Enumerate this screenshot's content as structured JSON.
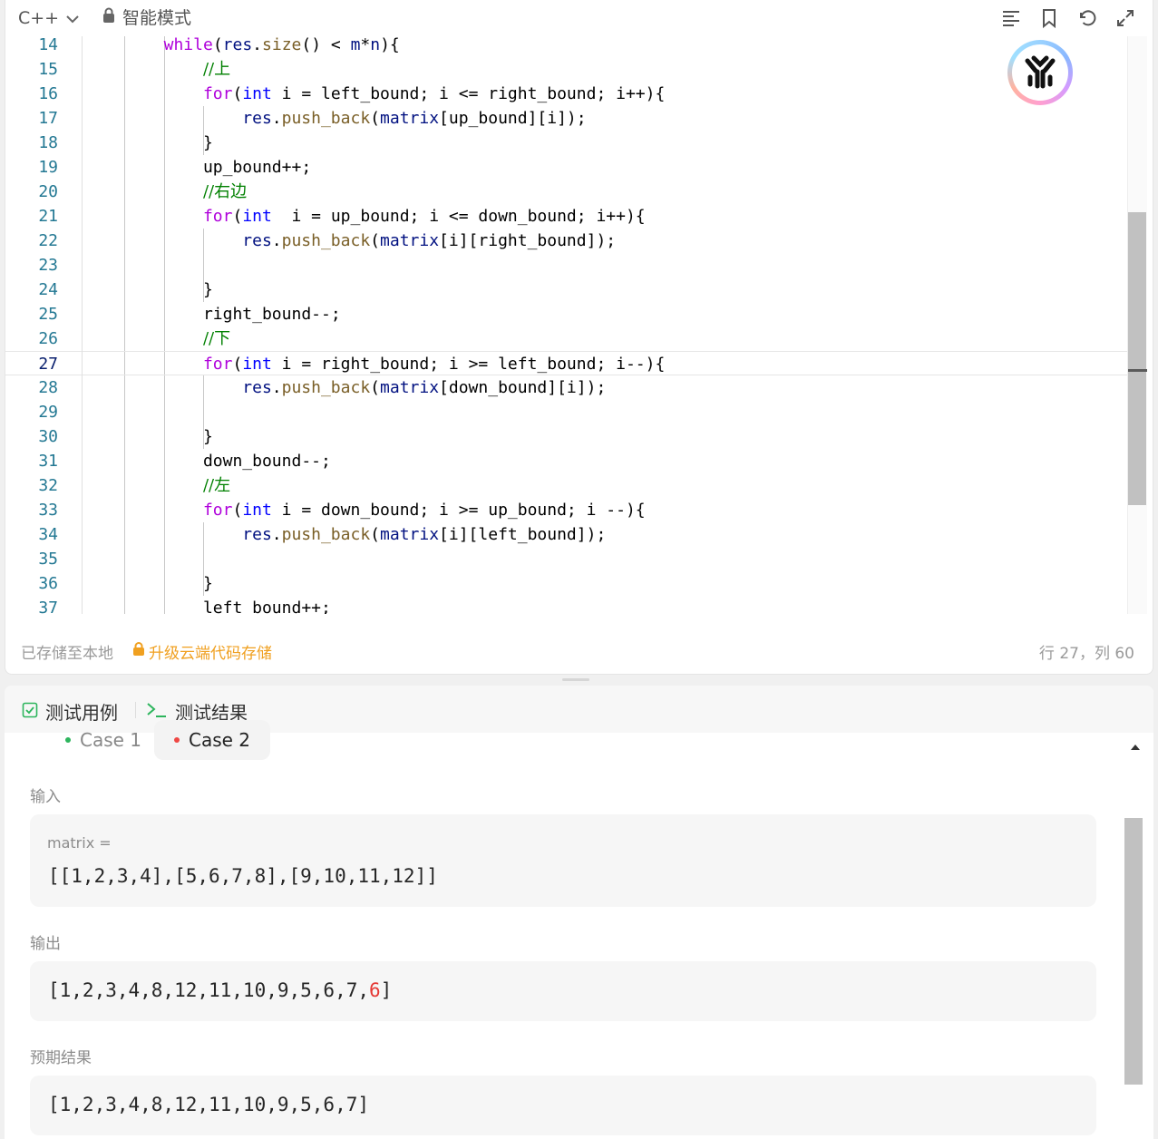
{
  "toolbar": {
    "language": "C++",
    "mode": "智能模式"
  },
  "code": {
    "lines": [
      {
        "n": "14",
        "html": "<span class=\"kw2\">while</span>(<span class=\"var\">res</span>.<span class=\"fn\">size</span>() &lt; <span class=\"var\">m</span>*<span class=\"var\">n</span>){"
      },
      {
        "n": "15",
        "html": "<span class=\"cm\">//上</span>"
      },
      {
        "n": "16",
        "html": "<span class=\"kw2\">for</span>(<span class=\"kw\">int</span> i = left_bound; i &lt;= right_bound; i++){"
      },
      {
        "n": "17",
        "html": "<span class=\"var\">res</span>.<span class=\"fn\">push_back</span>(<span class=\"var\">matrix</span>[up_bound][i]);"
      },
      {
        "n": "18",
        "html": "}"
      },
      {
        "n": "19",
        "html": "up_bound++;"
      },
      {
        "n": "20",
        "html": "<span class=\"cm\">//右边</span>"
      },
      {
        "n": "21",
        "html": "<span class=\"kw2\">for</span>(<span class=\"kw\">int</span>  i = up_bound; i &lt;= down_bound; i++){"
      },
      {
        "n": "22",
        "html": "<span class=\"var\">res</span>.<span class=\"fn\">push_back</span>(<span class=\"var\">matrix</span>[i][right_bound]);"
      },
      {
        "n": "23",
        "html": ""
      },
      {
        "n": "24",
        "html": "}"
      },
      {
        "n": "25",
        "html": "right_bound--;"
      },
      {
        "n": "26",
        "html": "<span class=\"cm\">//下</span>"
      },
      {
        "n": "27",
        "html": "<span class=\"kw2\">for</span>(<span class=\"kw\">int</span> i = right_bound; i &gt;= left_bound; i--){"
      },
      {
        "n": "28",
        "html": "<span class=\"var\">res</span>.<span class=\"fn\">push_back</span>(<span class=\"var\">matrix</span>[down_bound][i]);"
      },
      {
        "n": "29",
        "html": ""
      },
      {
        "n": "30",
        "html": "}"
      },
      {
        "n": "31",
        "html": "down_bound--;"
      },
      {
        "n": "32",
        "html": "<span class=\"cm\">//左</span>"
      },
      {
        "n": "33",
        "html": "<span class=\"kw2\">for</span>(<span class=\"kw\">int</span> i = down_bound; i &gt;= up_bound; i --){"
      },
      {
        "n": "34",
        "html": "<span class=\"var\">res</span>.<span class=\"fn\">push_back</span>(<span class=\"var\">matrix</span>[i][left_bound]);"
      },
      {
        "n": "35",
        "html": ""
      },
      {
        "n": "36",
        "html": "}"
      },
      {
        "n": "37",
        "html": "left_bound++;"
      }
    ],
    "active_line": "27"
  },
  "status": {
    "saved": "已存储至本地",
    "upgrade": "升级云端代码存储",
    "cursor": "行 27，列 60"
  },
  "result": {
    "tab_testcase": "测试用例",
    "tab_result": "测试结果",
    "case1": "Case 1",
    "case2": "Case 2",
    "case1_color": "#2db55d",
    "case2_color": "#ef4743",
    "input_label": "输入",
    "input_var": "matrix =",
    "input_value": "[[1,2,3,4],[5,6,7,8],[9,10,11,12]]",
    "output_label": "输出",
    "output_value_same": "[1,2,3,4,8,12,11,10,9,5,6,7,",
    "output_value_diff": "6",
    "output_value_end": "]",
    "expected_label": "预期结果",
    "expected_value": "[1,2,3,4,8,12,11,10,9,5,6,7]"
  },
  "icons": [
    "chevron-down-icon",
    "lock-icon",
    "format-icon",
    "bookmark-icon",
    "undo-icon",
    "expand-icon",
    "ai-assistant-icon",
    "checkbox-icon",
    "terminal-icon",
    "scroll-up-icon"
  ]
}
